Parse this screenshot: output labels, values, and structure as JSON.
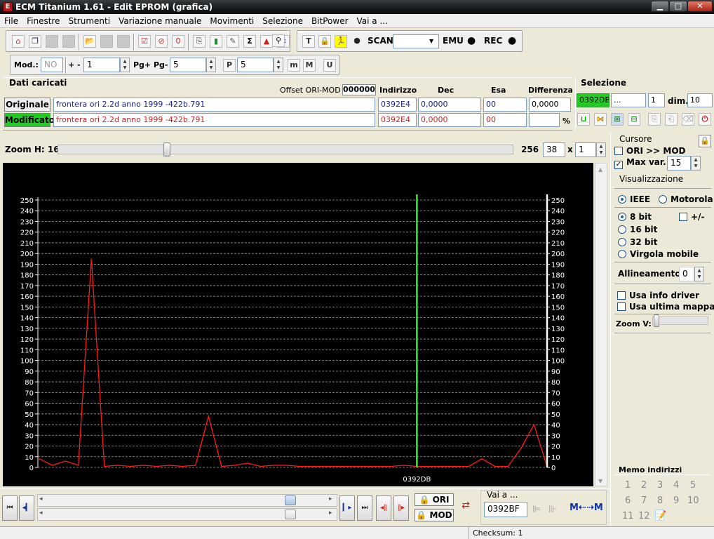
{
  "window": {
    "title": "ECM Titanium 1.61 - Edit EPROM (grafica)",
    "icon_glyph": "E",
    "minimize_glyph": "▁",
    "maximize_glyph": "□",
    "close_glyph": "✕"
  },
  "menu": [
    "File",
    "Finestre",
    "Strumenti",
    "Variazione manuale",
    "Movimenti",
    "Selezione",
    "BitPower",
    "Vai a ..."
  ],
  "toolbar1": {
    "icons": [
      "home-icon",
      "windows-icon",
      "grey-icon",
      "grey-icon",
      "folder-open-icon",
      "grey-icon",
      "grey-icon",
      "checklist-icon",
      "search-doc-icon",
      "zero-doc-icon",
      "copy-icon",
      "battery-icon",
      "tools-icon",
      "sigma-icon",
      "shapes-icon",
      "chart-icon",
      "binoculars-icon"
    ],
    "glyphs": [
      "⌂",
      "❐",
      "",
      "",
      "📂",
      "",
      "",
      "☑",
      "⊘",
      "0",
      "⎘",
      "▮",
      "✎",
      "Σ",
      "▲",
      "≋",
      "⚲"
    ]
  },
  "toolbar2": {
    "icons": [
      "text-icon",
      "lock-icon",
      "runner-icon",
      "record-dot-icon"
    ],
    "glyphs": [
      "T",
      "🔒",
      "🏃",
      "●"
    ],
    "scan_label": "SCAN",
    "scan_value": "",
    "emu_label": "EMU",
    "rec_label": "REC",
    "dot_glyph": "●",
    "combo_arrow": "▼"
  },
  "toolbar3": {
    "mod_label": "Mod.:",
    "mod_value": "NO",
    "pm_label": "+ -",
    "pm_value": "1",
    "pg_label": "Pg+ Pg-",
    "pg_value": "5",
    "p_button": "P",
    "p_value": "5",
    "m_lower": "m",
    "m_upper": "M",
    "u_button": "U",
    "spin_up": "▲",
    "spin_down": "▼"
  },
  "dati": {
    "title": "Dati caricati",
    "offset_label": "Offset ORI-MOD",
    "offset_value": "000000",
    "col_indirizzo": "Indirizzo",
    "col_dec": "Dec",
    "col_esa": "Esa",
    "col_diff": "Differenza",
    "originale_label": "Originale",
    "modificato_label": "Modificato",
    "ori_file": "frontera ori 2.2d anno 1999 -422b.791",
    "mod_file": "frontera ori 2.2d anno 1999 -422b.791",
    "ori_addr": "0392E4",
    "mod_addr": "0392E4",
    "ori_dec": "0,0000",
    "mod_dec": "0,0000",
    "ori_esa": "00",
    "mod_esa": "00",
    "ori_diff": "0,0000",
    "mod_diff": "",
    "percent": "%"
  },
  "selezione": {
    "title": "Selezione",
    "start": "0392DB",
    "end": "...",
    "count": "1",
    "dim_label": "dim.",
    "dim_value": "10"
  },
  "zoom_h": {
    "label": "Zoom H: 16",
    "max": "256",
    "value": "38",
    "x_label": "x",
    "mult": "1",
    "position": 0.24
  },
  "cursore": {
    "title": "Cursore",
    "ori_mod": "ORI >> MOD",
    "max_var_label": "Max var.",
    "max_var_value": "15",
    "check_glyph": "✓"
  },
  "visualizzazione": {
    "title": "Visualizzazione",
    "ieee": "IEEE",
    "motorola": "Motorola",
    "bit8": "8 bit",
    "plusminus": "+/-",
    "bit16": "16 bit",
    "bit32": "32 bit",
    "virgola": "Virgola mobile",
    "allineamento_label": "Allineamento:",
    "allineamento_value": "0",
    "usa_info": "Usa info driver",
    "usa_ultima": "Usa ultima mappa",
    "zoom_v": "Zoom V:"
  },
  "memo": {
    "title": "Memo indirizzi",
    "numbers": [
      "1",
      "2",
      "3",
      "4",
      "5",
      "6",
      "7",
      "8",
      "9",
      "10",
      "11",
      "12"
    ]
  },
  "bottom": {
    "first_glyph": "⏮",
    "prev_glyph": "◂▎",
    "next_glyph": "▎▸",
    "last_glyph": "⏭",
    "ori_button": "ORI",
    "mod_button": "MOD",
    "vai_label": "Vai a ...",
    "vai_value": "0392BF",
    "scroll_left": "◂",
    "scroll_right": "▸"
  },
  "status": {
    "checksum": "Checksum: 1"
  },
  "colors": {
    "chart_bg": "#000000",
    "series": "#ff1a1a",
    "cursor_green": "#33ee33",
    "cursor_white": "#ffffff",
    "grid": "#bdbdbd",
    "modificato_bg": "#22cc22",
    "ori_text": "#1a237e",
    "mod_text": "#c62828"
  },
  "chart_data": {
    "type": "line",
    "ylim": [
      0,
      250
    ],
    "yticks": [
      0,
      10,
      20,
      30,
      40,
      50,
      60,
      70,
      80,
      90,
      100,
      110,
      120,
      130,
      140,
      150,
      160,
      170,
      180,
      190,
      200,
      210,
      220,
      230,
      240,
      250
    ],
    "values": [
      8,
      2,
      6,
      2,
      195,
      1,
      2,
      1,
      2,
      1,
      2,
      1,
      2,
      48,
      1,
      2,
      4,
      1,
      2,
      2,
      1,
      1,
      1,
      1,
      1,
      1,
      1,
      1,
      2,
      1,
      1,
      1,
      1,
      1,
      8,
      1,
      1,
      18,
      40,
      1
    ],
    "cursor_label": "0392DB",
    "green_cursor_index": 29,
    "white_cursor_index": 39,
    "grid": true
  }
}
